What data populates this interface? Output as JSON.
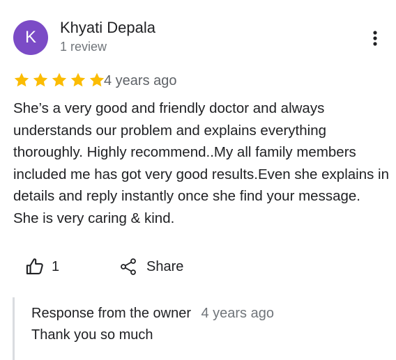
{
  "reviewer": {
    "initial": "K",
    "name": "Khyati Depala",
    "meta": "1 review",
    "avatar_color": "#7b4bc6"
  },
  "review": {
    "rating": 5,
    "rating_max": 5,
    "star_color": "#fbbc04",
    "date": "4 years ago",
    "text": "She’s a very good and friendly doctor and always understands our problem and explains everything thoroughly. Highly recommend..My all family members included me has got very good results.Even she explains in details and reply instantly once she find your message. She is very caring & kind."
  },
  "actions": {
    "like_icon": "thumb-up-icon",
    "like_count": "1",
    "share_icon": "share-icon",
    "share_label": "Share",
    "more_icon": "more-vert-icon"
  },
  "owner_response": {
    "title": "Response from the owner",
    "date": "4 years ago",
    "text": "Thank you so much"
  }
}
